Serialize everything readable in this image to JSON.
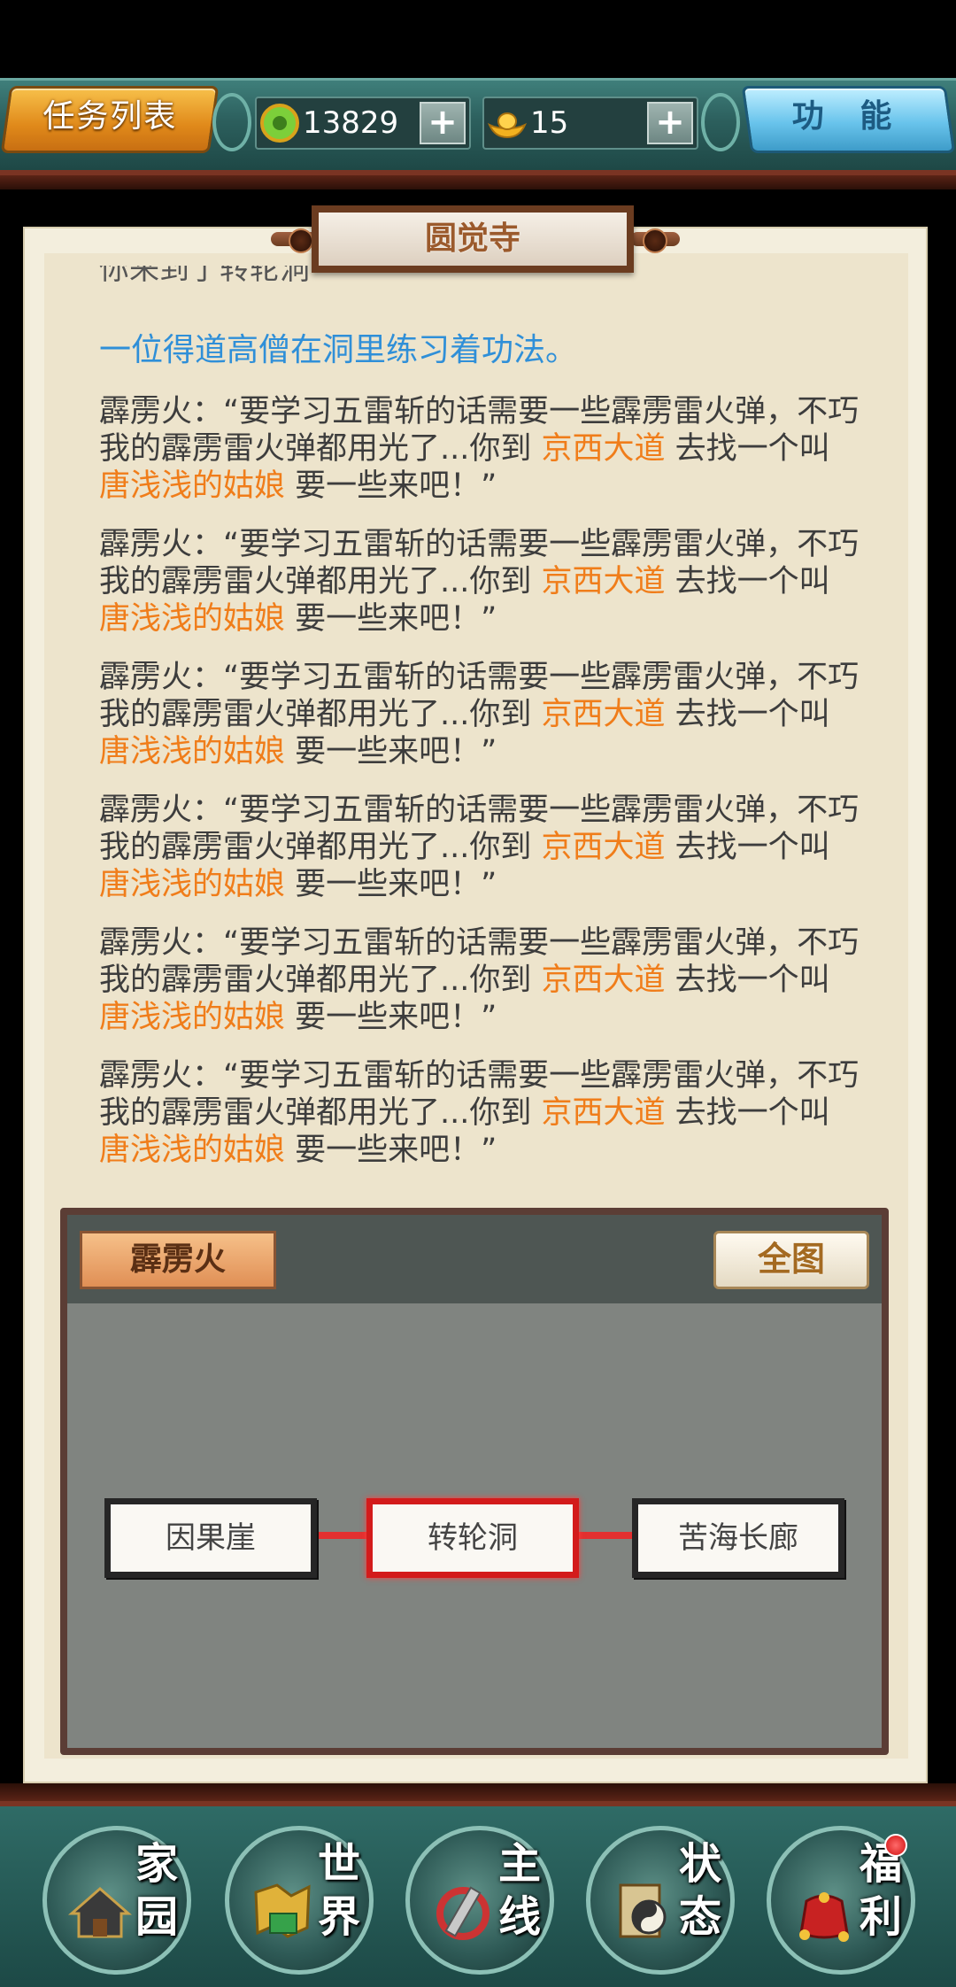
{
  "topbar": {
    "task_list_label": "任务列表",
    "function_label": "功 能",
    "currency_coins": "13829",
    "currency_ingots": "15",
    "plus_label": "+"
  },
  "panel": {
    "title": "圆觉寺",
    "cut_line": "你来到了转轮洞",
    "intro": "一位得道高僧在洞里练习着功法。",
    "paragraphs": [
      {
        "a": "霹雳火：“要学习五雷斩的话需要一些霹雳雷火弹，不巧我的霹雳雷火弹都用光了...你到 ",
        "place": "京西大道",
        "b": " 去找一个叫",
        "npc": "唐浅浅的姑娘",
        "c": " 要一些来吧！”"
      },
      {
        "a": "霹雳火：“要学习五雷斩的话需要一些霹雳雷火弹，不巧我的霹雳雷火弹都用光了...你到 ",
        "place": "京西大道",
        "b": " 去找一个叫",
        "npc": "唐浅浅的姑娘",
        "c": " 要一些来吧！”"
      },
      {
        "a": "霹雳火：“要学习五雷斩的话需要一些霹雳雷火弹，不巧我的霹雳雷火弹都用光了...你到 ",
        "place": "京西大道",
        "b": " 去找一个叫",
        "npc": "唐浅浅的姑娘",
        "c": " 要一些来吧！”"
      },
      {
        "a": "霹雳火：“要学习五雷斩的话需要一些霹雳雷火弹，不巧我的霹雳雷火弹都用光了...你到 ",
        "place": "京西大道",
        "b": " 去找一个叫",
        "npc": "唐浅浅的姑娘",
        "c": " 要一些来吧！”"
      },
      {
        "a": "霹雳火：“要学习五雷斩的话需要一些霹雳雷火弹，不巧我的霹雳雷火弹都用光了...你到 ",
        "place": "京西大道",
        "b": " 去找一个叫",
        "npc": "唐浅浅的姑娘",
        "c": " 要一些来吧！”"
      },
      {
        "a": "霹雳火：“要学习五雷斩的话需要一些霹雳雷火弹，不巧我的霹雳雷火弹都用光了...你到 ",
        "place": "京西大道",
        "b": " 去找一个叫",
        "npc": "唐浅浅的姑娘",
        "c": " 要一些来吧！”"
      }
    ]
  },
  "map": {
    "npc_name": "霹雳火",
    "full_map_label": "全图",
    "locations": [
      "因果崖",
      "转轮洞",
      "苦海长廊"
    ],
    "current_location": "转轮洞"
  },
  "nav": {
    "items": [
      {
        "label": "家园",
        "l1": "家",
        "l2": "园",
        "icon": "home-icon"
      },
      {
        "label": "世界",
        "l1": "世",
        "l2": "界",
        "icon": "world-map-icon"
      },
      {
        "label": "主线",
        "l1": "主",
        "l2": "线",
        "icon": "main-quest-icon"
      },
      {
        "label": "状态",
        "l1": "状",
        "l2": "态",
        "icon": "status-icon"
      },
      {
        "label": "福利",
        "l1": "福",
        "l2": "利",
        "icon": "gift-bag-icon"
      }
    ]
  },
  "colors": {
    "highlight_orange": "#f07d1a",
    "intro_blue": "#2f8fd8",
    "current_location_red": "#d31b1b"
  }
}
